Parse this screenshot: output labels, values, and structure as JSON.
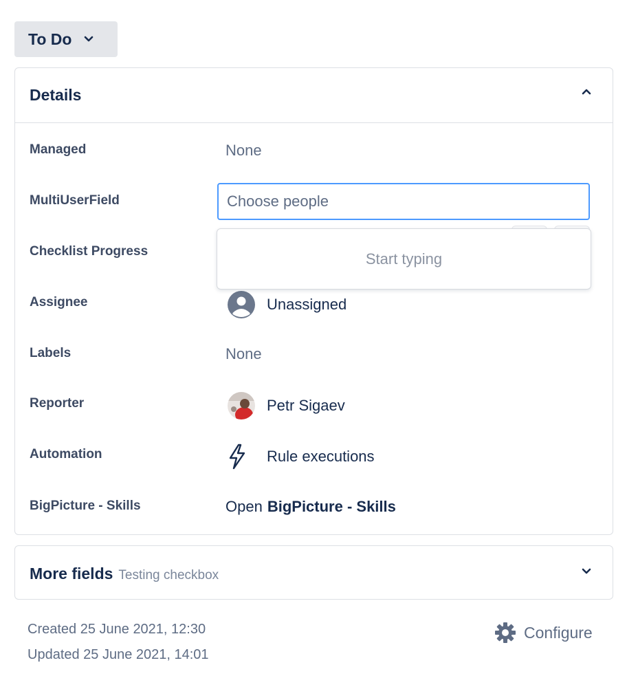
{
  "status": {
    "label": "To Do",
    "icon": "chevron-down-icon"
  },
  "details": {
    "title": "Details",
    "fields": {
      "managed": {
        "label": "Managed",
        "value": "None"
      },
      "multi_user": {
        "label": "MultiUserField",
        "placeholder": "Choose people",
        "dropdown_text": "Start typing"
      },
      "checklist": {
        "label": "Checklist Progress"
      },
      "assignee": {
        "label": "Assignee",
        "value": "Unassigned",
        "icon": "user-avatar-icon"
      },
      "labels": {
        "label": "Labels",
        "value": "None"
      },
      "reporter": {
        "label": "Reporter",
        "value": "Petr Sigaev",
        "icon": "avatar"
      },
      "automation": {
        "label": "Automation",
        "value": "Rule executions",
        "icon": "lightning-icon"
      },
      "bigpicture": {
        "label": "BigPicture - Skills",
        "prefix": "Open",
        "link": "BigPicture - Skills"
      }
    }
  },
  "more_fields": {
    "title": "More fields",
    "subtitle": "Testing checkbox"
  },
  "footer": {
    "created": "Created 25 June 2021, 12:30",
    "updated": "Updated 25 June 2021, 14:01",
    "configure_label": "Configure"
  },
  "colors": {
    "focus_border": "#4c9aff",
    "status_bg": "#e4e6ea",
    "text": "#172b4d"
  }
}
